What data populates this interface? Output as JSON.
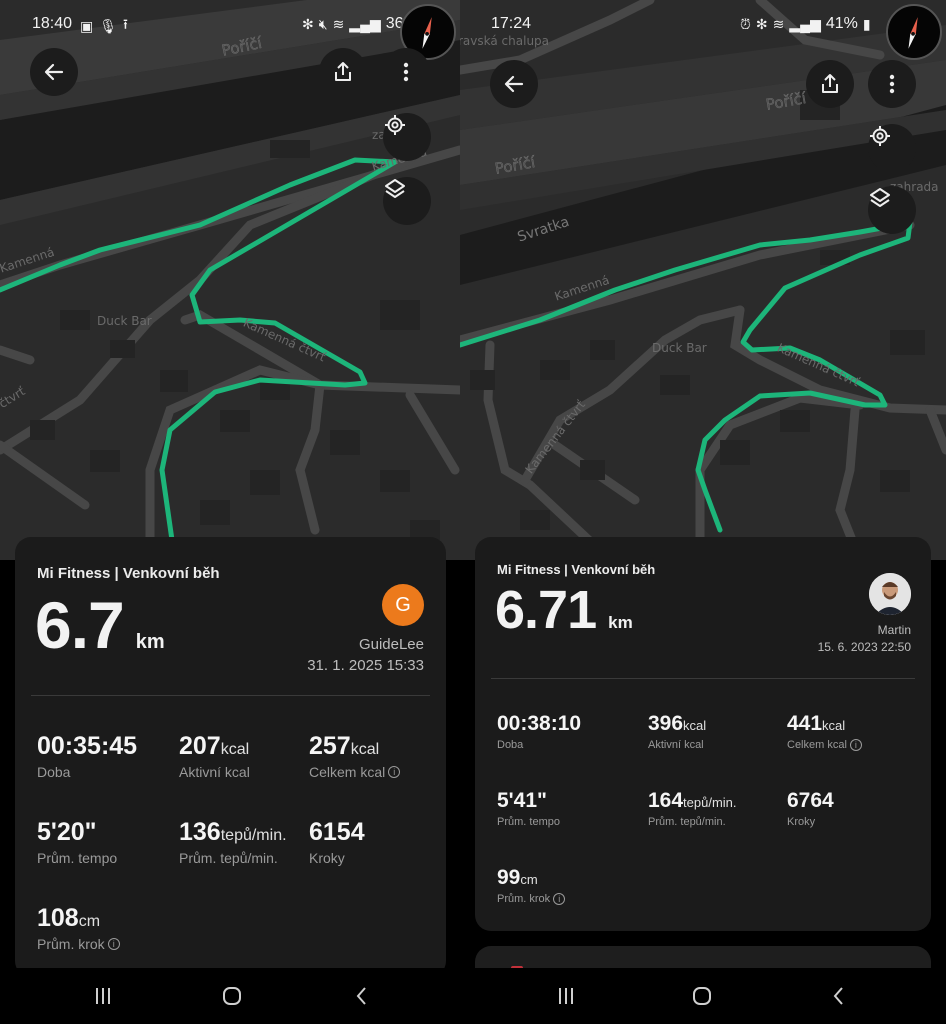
{
  "screens": {
    "left": {
      "status_bar": {
        "time": "18:40",
        "left_icons": [
          "image-icon",
          "microphone-icon",
          "upload-icon"
        ],
        "right_icons": [
          "bluetooth-icon",
          "mute-icon",
          "wifi-icon",
          "signal-icon"
        ],
        "battery": "36%"
      },
      "map": {
        "labels": [
          "Poříčí",
          "za řekou",
          "Kamenná",
          "Kamenná",
          "Duck Bar",
          "Kamenná čtvrť",
          "čtvrť"
        ],
        "route_color": "#1db57a"
      },
      "card": {
        "title": "Mi Fitness | Venkovní běh",
        "distance_value": "6.7",
        "distance_unit": "km",
        "user_initial": "G",
        "avatar_color": "#ec7a1c",
        "user_name": "GuideLee",
        "datetime": "31. 1. 2025 15:33",
        "stats": [
          {
            "value": "00:35:45",
            "unit": "",
            "label": "Doba",
            "info": false
          },
          {
            "value": "207",
            "unit": "kcal",
            "label": "Aktivní kcal",
            "info": false
          },
          {
            "value": "257",
            "unit": "kcal",
            "label": "Celkem kcal",
            "info": true
          },
          {
            "value": "5'20\"",
            "unit": "",
            "label": "Prům. tempo",
            "info": false
          },
          {
            "value": "136",
            "unit": "tepů/min.",
            "label": "Prům. tepů/min.",
            "info": false
          },
          {
            "value": "6154",
            "unit": "",
            "label": "Kroky",
            "info": false
          },
          {
            "value": "108",
            "unit": "cm",
            "label": "Prům. krok",
            "info": true
          }
        ]
      }
    },
    "right": {
      "status_bar": {
        "time": "17:24",
        "right_icons": [
          "alarm-icon",
          "bluetooth-icon",
          "wifi-icon",
          "signal-icon"
        ],
        "battery": "41%"
      },
      "map": {
        "labels": [
          "ravská chalupa",
          "Poříčí",
          "Poříčí",
          "Svratka",
          "zahrada",
          "Kamenná",
          "Duck Bar",
          "Kamenná čtvrť",
          "Kamenná čtvrť"
        ],
        "route_color": "#1db57a"
      },
      "card": {
        "title": "Mi Fitness | Venkovní běh",
        "distance_value": "6.71",
        "distance_unit": "km",
        "user_name": "Martin",
        "datetime": "15. 6. 2023 22:50",
        "stats": [
          {
            "value": "00:38:10",
            "unit": "",
            "label": "Doba",
            "info": false
          },
          {
            "value": "396",
            "unit": "kcal",
            "label": "Aktivní kcal",
            "info": false
          },
          {
            "value": "441",
            "unit": "kcal",
            "label": "Celkem kcal",
            "info": true
          },
          {
            "value": "5'41\"",
            "unit": "",
            "label": "Prům. tempo",
            "info": false
          },
          {
            "value": "164",
            "unit": "tepů/min.",
            "label": "Prům. tepů/min.",
            "info": false
          },
          {
            "value": "6764",
            "unit": "",
            "label": "Kroky",
            "info": false
          },
          {
            "value": "99",
            "unit": "cm",
            "label": "Prům. krok",
            "info": true
          }
        ]
      }
    }
  },
  "icons": {
    "info": "i"
  }
}
